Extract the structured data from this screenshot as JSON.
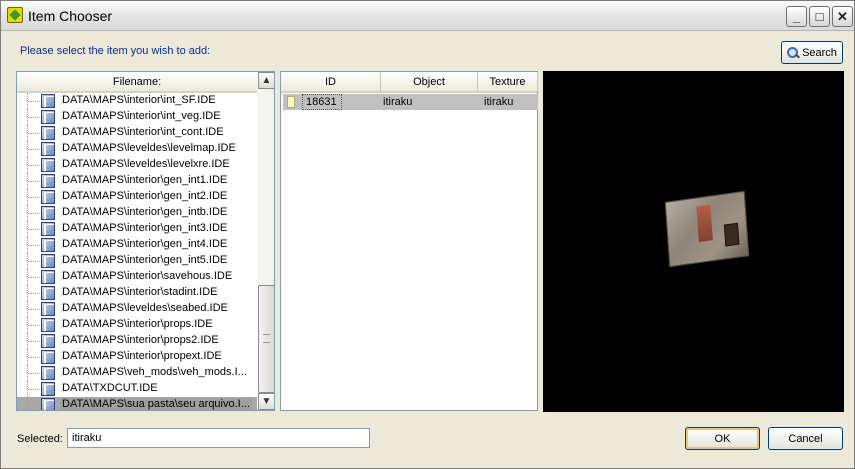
{
  "window": {
    "title": "Item Chooser",
    "controls": {
      "minimize": "_",
      "maximize": "□",
      "close": "✕"
    }
  },
  "prompt": "Please select the item you wish to add:",
  "search_button": {
    "label": "Search",
    "icon": "magnifier-icon"
  },
  "file_list": {
    "header": "Filename:",
    "items": [
      "DATA\\MAPS\\interior\\int_SF.IDE",
      "DATA\\MAPS\\interior\\int_veg.IDE",
      "DATA\\MAPS\\interior\\int_cont.IDE",
      "DATA\\MAPS\\leveldes\\levelmap.IDE",
      "DATA\\MAPS\\leveldes\\levelxre.IDE",
      "DATA\\MAPS\\interior\\gen_int1.IDE",
      "DATA\\MAPS\\interior\\gen_int2.IDE",
      "DATA\\MAPS\\interior\\gen_intb.IDE",
      "DATA\\MAPS\\interior\\gen_int3.IDE",
      "DATA\\MAPS\\interior\\gen_int4.IDE",
      "DATA\\MAPS\\interior\\gen_int5.IDE",
      "DATA\\MAPS\\interior\\savehous.IDE",
      "DATA\\MAPS\\interior\\stadint.IDE",
      "DATA\\MAPS\\leveldes\\seabed.IDE",
      "DATA\\MAPS\\interior\\props.IDE",
      "DATA\\MAPS\\interior\\props2.IDE",
      "DATA\\MAPS\\interior\\propext.IDE",
      "DATA\\MAPS\\veh_mods\\veh_mods.I...",
      "DATA\\TXDCUT.IDE",
      "DATA\\MAPS\\sua pasta\\seu arquivo.I..."
    ],
    "selected_index": 19,
    "scroll_up": "▲",
    "scroll_down": "▼"
  },
  "object_table": {
    "columns": [
      "ID",
      "Object",
      "Texture"
    ],
    "rows": [
      {
        "id": "18631",
        "object": "itiraku",
        "texture": "itiraku"
      }
    ]
  },
  "selected": {
    "label": "Selected:",
    "value": "itiraku"
  },
  "buttons": {
    "ok": "OK",
    "cancel": "Cancel"
  }
}
